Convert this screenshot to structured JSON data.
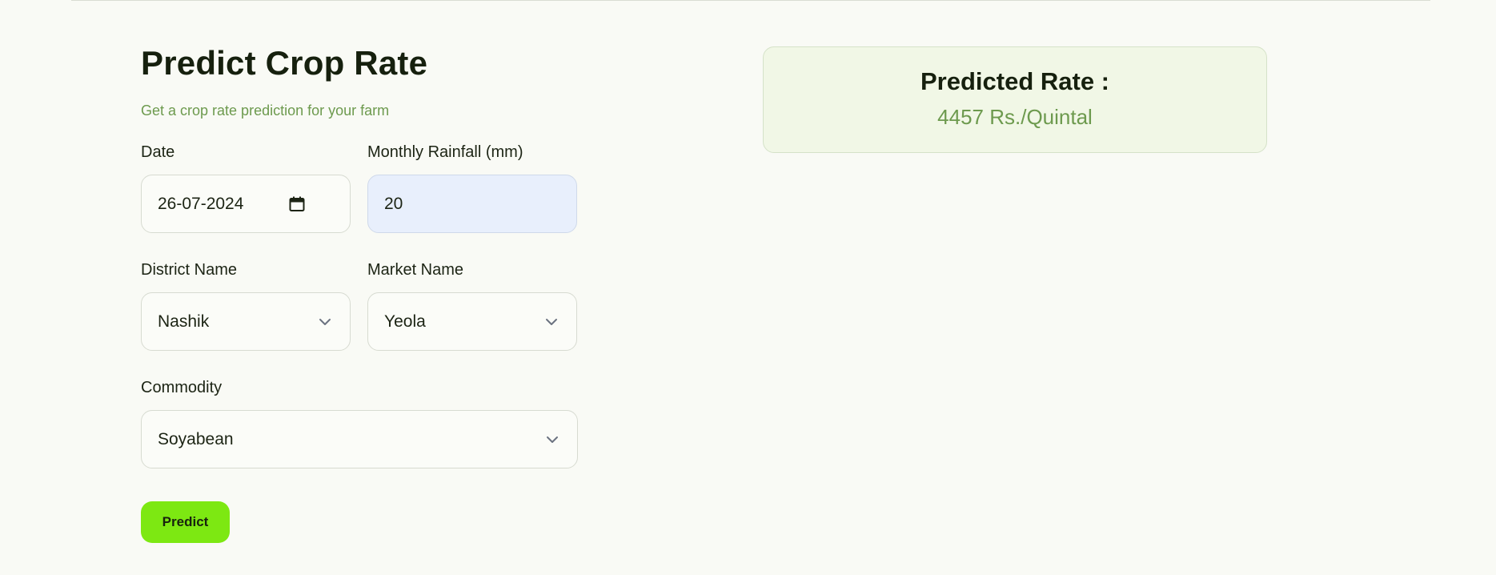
{
  "page": {
    "title": "Predict Crop Rate",
    "subtitle": "Get a crop rate prediction for your farm"
  },
  "form": {
    "date": {
      "label": "Date",
      "value": "26-07-2024",
      "icon": "calendar-icon"
    },
    "rainfall": {
      "label": "Monthly Rainfall (mm)",
      "value": "20"
    },
    "district": {
      "label": "District Name",
      "value": "Nashik",
      "icon": "chevron-down-icon"
    },
    "market": {
      "label": "Market Name",
      "value": "Yeola",
      "icon": "chevron-down-icon"
    },
    "commodity": {
      "label": "Commodity",
      "value": "Soyabean",
      "icon": "chevron-down-icon"
    },
    "submit_label": "Predict"
  },
  "result": {
    "title": "Predicted Rate :",
    "value": "4457 Rs./Quintal"
  },
  "colors": {
    "background": "#f9faf5",
    "accent_button": "#7de812",
    "subtitle_green": "#6d9a4e",
    "result_card_bg": "#f1f7e6",
    "filled_input_bg": "#e8effc"
  }
}
